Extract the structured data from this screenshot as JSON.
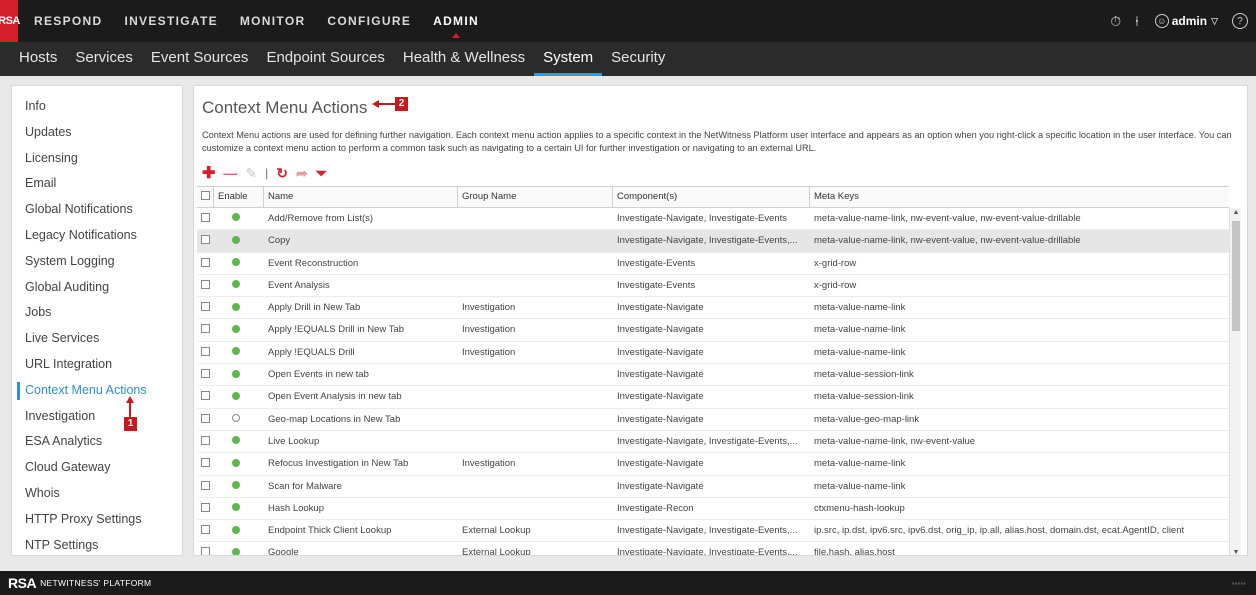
{
  "topnav": {
    "logo": "RSA",
    "items": [
      "RESPOND",
      "INVESTIGATE",
      "MONITOR",
      "CONFIGURE",
      "ADMIN"
    ],
    "active": "ADMIN",
    "user": "admin"
  },
  "subnav": {
    "items": [
      "Hosts",
      "Services",
      "Event Sources",
      "Endpoint Sources",
      "Health & Wellness",
      "System",
      "Security"
    ],
    "active": "System"
  },
  "sidebar": {
    "items": [
      "Info",
      "Updates",
      "Licensing",
      "Email",
      "Global Notifications",
      "Legacy Notifications",
      "System Logging",
      "Global Auditing",
      "Jobs",
      "Live Services",
      "URL Integration",
      "Context Menu Actions",
      "Investigation",
      "ESA Analytics",
      "Cloud Gateway",
      "Whois",
      "HTTP Proxy Settings",
      "NTP Settings"
    ],
    "active_index": 11
  },
  "main": {
    "title": "Context Menu Actions",
    "description": "Context Menu actions are used for defining further navigation. Each context menu action applies to a specific context in the NetWitness Platform user interface and appears as an option when you right-click a specific location in the user interface. You can customize a context menu action to perform a common task such as navigating to a certain UI for further investigation or navigating to an external URL."
  },
  "table": {
    "headers": [
      "Enable",
      "Name",
      "Group Name",
      "Component(s)",
      "Meta Keys"
    ],
    "rows": [
      {
        "enabled": true,
        "name": "Add/Remove from List(s)",
        "group": "",
        "components": "Investigate-Navigate, Investigate-Events",
        "meta": "meta-value-name-link, nw-event-value, nw-event-value-drillable",
        "selected": false
      },
      {
        "enabled": true,
        "name": "Copy",
        "group": "",
        "components": "Investigate-Navigate, Investigate-Events,...",
        "meta": "meta-value-name-link, nw-event-value, nw-event-value-drillable",
        "selected": true
      },
      {
        "enabled": true,
        "name": "Event Reconstruction",
        "group": "",
        "components": "Investigate-Events",
        "meta": "x-grid-row",
        "selected": false
      },
      {
        "enabled": true,
        "name": "Event Analysis",
        "group": "",
        "components": "Investigate-Events",
        "meta": "x-grid-row",
        "selected": false
      },
      {
        "enabled": true,
        "name": "Apply Drill in New Tab",
        "group": "Investigation",
        "components": "Investigate-Navigate",
        "meta": "meta-value-name-link",
        "selected": false
      },
      {
        "enabled": true,
        "name": "Apply !EQUALS Drill in New Tab",
        "group": "Investigation",
        "components": "Investigate-Navigate",
        "meta": "meta-value-name-link",
        "selected": false
      },
      {
        "enabled": true,
        "name": "Apply !EQUALS Drill",
        "group": "Investigation",
        "components": "Investigate-Navigate",
        "meta": "meta-value-name-link",
        "selected": false
      },
      {
        "enabled": true,
        "name": "Open Events in new tab",
        "group": "",
        "components": "Investigate-Navigate",
        "meta": "meta-value-session-link",
        "selected": false
      },
      {
        "enabled": true,
        "name": "Open Event Analysis in new tab",
        "group": "",
        "components": "Investigate-Navigate",
        "meta": "meta-value-session-link",
        "selected": false
      },
      {
        "enabled": false,
        "name": "Geo-map Locations in New Tab",
        "group": "",
        "components": "Investigate-Navigate",
        "meta": "meta-value-geo-map-link",
        "selected": false
      },
      {
        "enabled": true,
        "name": "Live Lookup",
        "group": "",
        "components": "Investigate-Navigate, Investigate-Events,...",
        "meta": "meta-value-name-link, nw-event-value",
        "selected": false
      },
      {
        "enabled": true,
        "name": "Refocus Investigation in New Tab",
        "group": "Investigation",
        "components": "Investigate-Navigate",
        "meta": "meta-value-name-link",
        "selected": false
      },
      {
        "enabled": true,
        "name": "Scan for Malware",
        "group": "",
        "components": "Investigate-Navigate",
        "meta": "meta-value-name-link",
        "selected": false
      },
      {
        "enabled": true,
        "name": "Hash Lookup",
        "group": "",
        "components": "Investigate-Recon",
        "meta": "ctxmenu-hash-lookup",
        "selected": false
      },
      {
        "enabled": true,
        "name": "Endpoint Thick Client Lookup",
        "group": "External Lookup",
        "components": "Investigate-Navigate, Investigate-Events,...",
        "meta": "ip.src, ip.dst, ipv6.src, ipv6.dst, orig_ip, ip.all, alias.host, domain.dst, ecat.AgentID, client",
        "selected": false
      },
      {
        "enabled": true,
        "name": "Google",
        "group": "External Lookup",
        "components": "Investigate-Navigate, Investigate-Events,...",
        "meta": "file.hash, alias.host",
        "selected": false
      }
    ]
  },
  "callouts": {
    "one": "1",
    "two": "2"
  },
  "footer": {
    "brand": "RSA",
    "brand_sub": "NETWITNESS' PLATFORM"
  },
  "colors": {
    "accent_red": "#d4202c",
    "accent_blue": "#2f8fd3",
    "enabled_green": "#5cb84a"
  }
}
